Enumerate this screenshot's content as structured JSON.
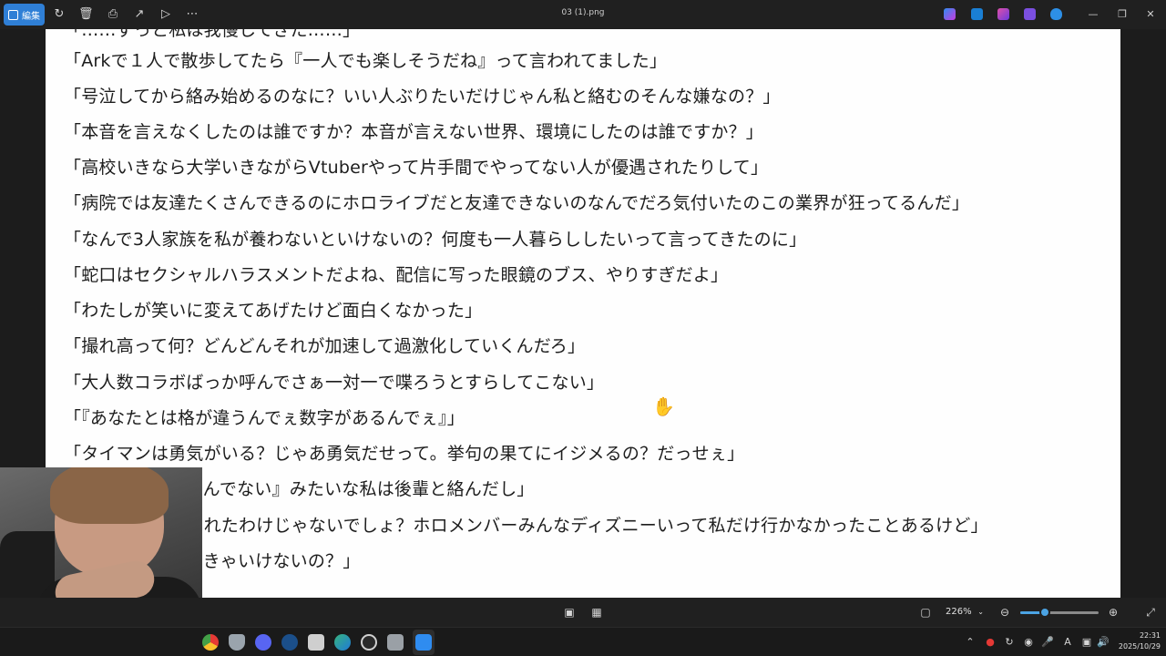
{
  "toolbar": {
    "edit_label": "編集",
    "filename": "03 (1).png",
    "icons": [
      "rotate-icon",
      "delete-icon",
      "print-icon",
      "share-icon",
      "slideshow-icon",
      "more-icon"
    ]
  },
  "document": {
    "cut_line": "「……ずっと私は我慢してきた……」",
    "lines": [
      "「Arkで１人で散歩してたら『一人でも楽しそうだね』って言われてました」",
      "「号泣してから絡み始めるのなに？いい人ぶりたいだけじゃん私と絡むのそんな嫌なの？」",
      "「本音を言えなくしたのは誰ですか？本音が言えない世界、環境にしたのは誰ですか？」",
      "「高校いきなら大学いきながらVtuberやって片手間でやってない人が優遇されたりして」",
      "「病院では友達たくさんできるのにホロライブだと友達できないのなんでだろ気付いたのこの業界が狂ってるんだ」",
      "「なんで3人家族を私が養わないといけないの？何度も一人暮らししたいって言ってきたのに」",
      "「蛇口はセクシャルハラスメントだよね、配信に写った眼鏡のブス、やりすぎだよ」",
      "「わたしが笑いに変えてあげたけど面白くなかった」",
      "「撮れ高って何？どんどんそれが加速して過激化していくんだろ」",
      "「大人数コラボばっか呼んでさぁ一対一で喋ろうとすらしてこない」",
      "「『あなたとは格が違うんでぇ数字があるんでぇ』」",
      "「タイマンは勇気がいる？じゃあ勇気だせって。挙句の果てにイジメるの？だっせぇ」",
      "「だって『人と絡んでない』みたいな私は後輩と絡んだし」",
      "「同期からハブられたわけじゃないでしょ？ホロメンバーみんなディズニーいって私だけ行かなかったことあるけど」",
      "「なんで私がしなきゃいけないの？」"
    ]
  },
  "viewer": {
    "zoom_label": "226%",
    "zoom_fraction": 0.31
  },
  "taskbar": {
    "time": "22:31",
    "date": "2025/10/29",
    "ime_indicator": "A"
  },
  "colors": {
    "accent": "#2f7fd6",
    "slider": "#4ba3e3",
    "page_bg": "#fefefe",
    "chrome_bg": "#202020"
  }
}
